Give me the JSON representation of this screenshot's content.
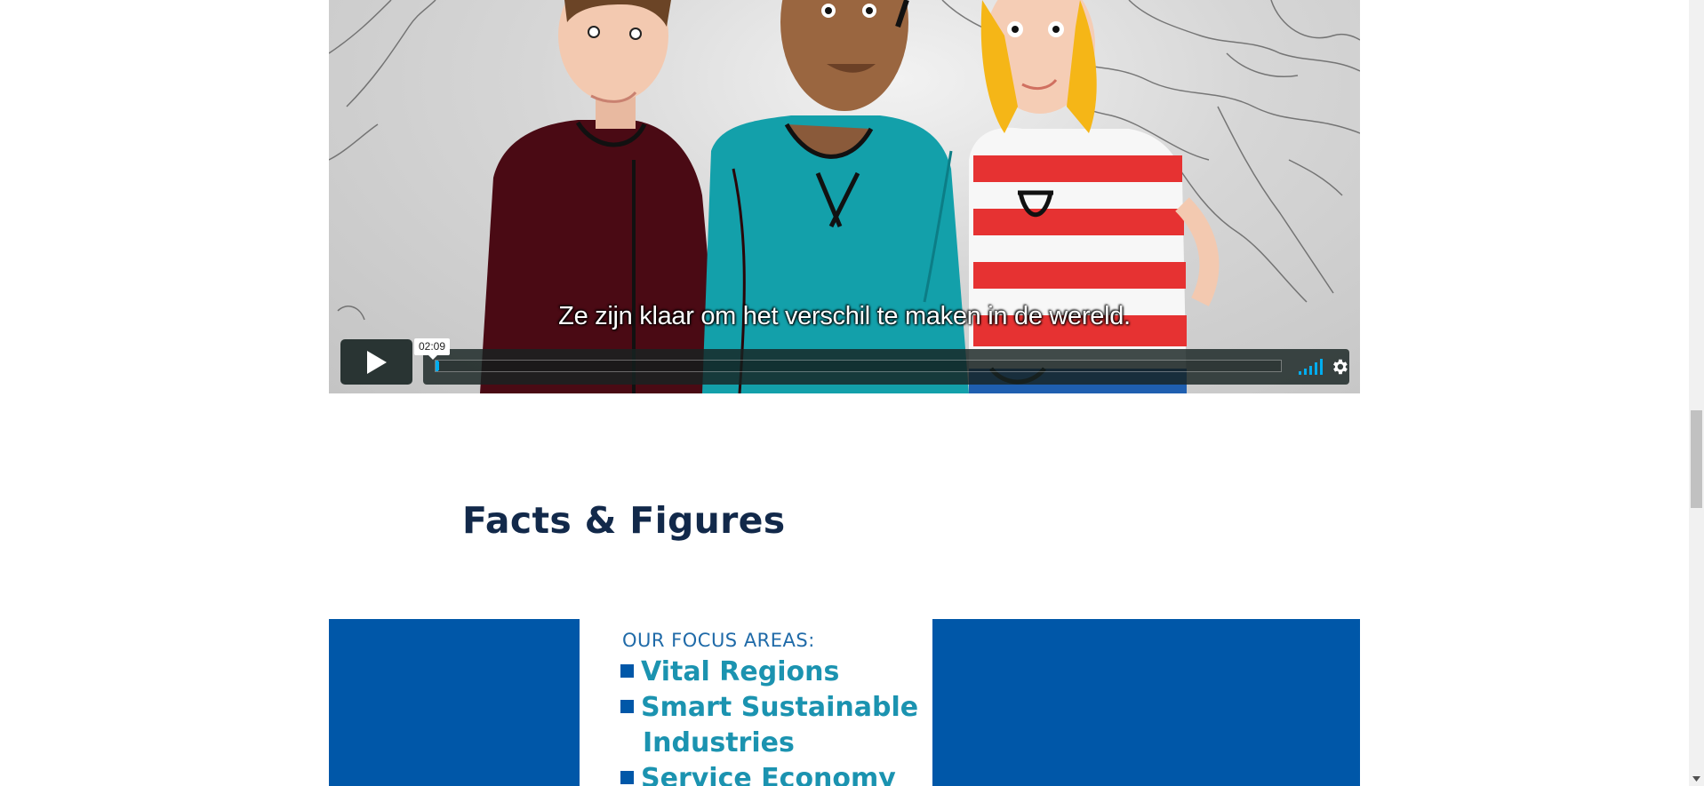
{
  "video": {
    "subtitle": "Ze zijn klaar om het verschil te maken in de wereld.",
    "hover_time": "02:09",
    "progress_fraction": 0.003,
    "accent_color": "#00adef",
    "icons": {
      "play": "play-icon",
      "volume": "volume-icon",
      "settings": "gear-icon"
    }
  },
  "section": {
    "title": "Facts & Figures"
  },
  "banner": {
    "heading": "OUR FOCUS AREAS:",
    "items": [
      "Vital Regions",
      "Smart Sustainable",
      "Industries",
      "Service Economy"
    ],
    "brand_color": "#0057a8",
    "text_color": "#1b93b0"
  }
}
